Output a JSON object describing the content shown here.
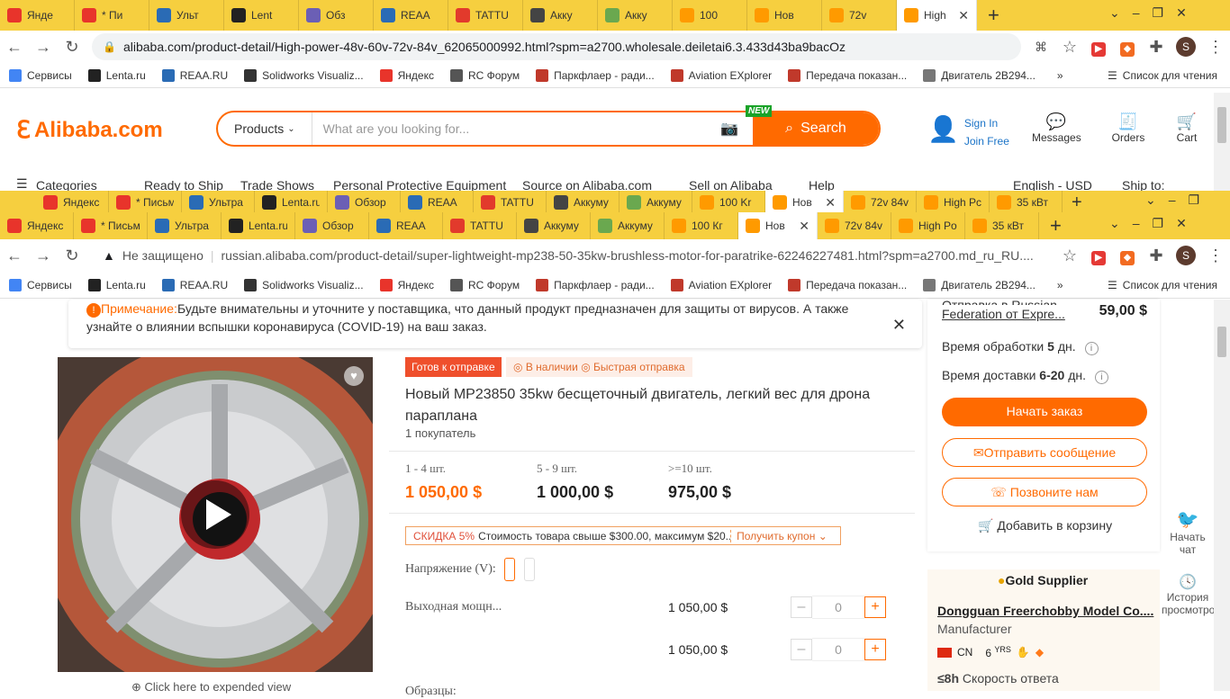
{
  "back_window": {
    "tabs": [
      {
        "label": "Янде",
        "icon": "yandex-icon",
        "color": "#e8342b"
      },
      {
        "label": "* Пи",
        "icon": "mail-icon",
        "color": "#e8342b"
      },
      {
        "label": "Ульт",
        "icon": "reaa-icon",
        "color": "#2a6bb5"
      },
      {
        "label": "Lent",
        "icon": "lenta-icon",
        "color": "#222222"
      },
      {
        "label": "Обз",
        "icon": "avatar-icon",
        "color": "#6b5fb5"
      },
      {
        "label": "REAA",
        "icon": "reaa-icon",
        "color": "#2a6bb5"
      },
      {
        "label": "TATTU",
        "icon": "tattu-icon",
        "color": "#e23a2c"
      },
      {
        "label": "Акку",
        "icon": "battery-icon",
        "color": "#444444"
      },
      {
        "label": "Акку",
        "icon": "dots-icon",
        "color": "#6aa84f"
      },
      {
        "label": "100",
        "icon": "alibaba-icon",
        "color": "#ff9a00"
      },
      {
        "label": "Нов",
        "icon": "alibaba-icon",
        "color": "#ff9a00"
      },
      {
        "label": "72v",
        "icon": "alibaba-icon",
        "color": "#ff9a00"
      },
      {
        "label": "High",
        "icon": "alibaba-icon",
        "color": "#ff9a00",
        "active": true
      }
    ],
    "url": "alibaba.com/product-detail/High-power-48v-60v-72v-84v_62065000992.html?spm=a2700.wholesale.deiletai6.3.433d43ba9bacOz",
    "profile_letter": "S"
  },
  "bookmarks": [
    {
      "label": "Сервисы",
      "icon": "apps-grid-icon",
      "color": "#4285f4"
    },
    {
      "label": "Lenta.ru",
      "icon": "lenta-icon",
      "color": "#222222"
    },
    {
      "label": "REAA.RU",
      "icon": "reaa-icon",
      "color": "#2a6bb5"
    },
    {
      "label": "Solidworks Visualiz...",
      "icon": "solidworks-icon",
      "color": "#333333"
    },
    {
      "label": "Яндекс",
      "icon": "yandex-icon",
      "color": "#e8342b"
    },
    {
      "label": "RC Форум",
      "icon": "rc-forum-icon",
      "color": "#555555"
    },
    {
      "label": "Паркфлаер - ради...",
      "icon": "parkflyer-icon",
      "color": "#c0392b"
    },
    {
      "label": "Aviation EXplorer",
      "icon": "aex-icon",
      "color": "#c0392b"
    },
    {
      "label": "Передача показан...",
      "icon": "document-icon",
      "color": "#c0392b"
    },
    {
      "label": "Двигатель 2В294...",
      "icon": "plane-icon",
      "color": "#777777"
    }
  ],
  "reading_list": "Список для чтения",
  "alibaba": {
    "logo": "Alibaba.com",
    "category": "Products",
    "search_placeholder": "What are you looking for...",
    "new_badge": "NEW",
    "search_button": "Search",
    "sign_in": "Sign In",
    "join_free": "Join Free",
    "messages": "Messages",
    "orders": "Orders",
    "cart": "Cart",
    "nav": [
      "Categories",
      "Ready to Ship",
      "Trade Shows",
      "Personal Protective Equipment",
      "Source on Alibaba.com",
      "Sell on Alibaba",
      "Help",
      "English - USD",
      "Ship to:"
    ]
  },
  "middle_window": {
    "tabs": [
      {
        "label": "Яндекс",
        "color": "#e8342b"
      },
      {
        "label": "* Письм",
        "color": "#e8342b"
      },
      {
        "label": "Ультра",
        "color": "#2a6bb5"
      },
      {
        "label": "Lenta.ru",
        "color": "#222222"
      },
      {
        "label": "Обзор",
        "color": "#6b5fb5"
      },
      {
        "label": "REAA",
        "color": "#2a6bb5"
      },
      {
        "label": "TATTU",
        "color": "#e23a2c"
      },
      {
        "label": "Аккуму",
        "color": "#444444"
      },
      {
        "label": "Аккуму",
        "color": "#6aa84f"
      },
      {
        "label": "100 Kr",
        "color": "#ff9a00"
      },
      {
        "label": "Нов",
        "color": "#ff9a00",
        "active": true
      },
      {
        "label": "72v 84v",
        "color": "#ff9a00"
      },
      {
        "label": "High Pc",
        "color": "#ff9a00"
      },
      {
        "label": "35 кВт",
        "color": "#ff9a00"
      }
    ]
  },
  "front_window": {
    "tabs": [
      {
        "label": "Яндекс",
        "color": "#e8342b"
      },
      {
        "label": "* Письм",
        "color": "#e8342b"
      },
      {
        "label": "Ультра",
        "color": "#2a6bb5"
      },
      {
        "label": "Lenta.ru",
        "color": "#222222"
      },
      {
        "label": "Обзор",
        "color": "#6b5fb5"
      },
      {
        "label": "REAA",
        "color": "#2a6bb5"
      },
      {
        "label": "TATTU",
        "color": "#e23a2c"
      },
      {
        "label": "Аккуму",
        "color": "#444444"
      },
      {
        "label": "Аккуму",
        "color": "#6aa84f"
      },
      {
        "label": "100 Кг",
        "color": "#ff9a00"
      },
      {
        "label": "Нов",
        "color": "#ff9a00",
        "active": true
      },
      {
        "label": "72v 84v",
        "color": "#ff9a00"
      },
      {
        "label": "High Po",
        "color": "#ff9a00"
      },
      {
        "label": "35 кВт",
        "color": "#ff9a00"
      }
    ],
    "insecure": "Не защищено",
    "url": "russian.alibaba.com/product-detail/super-lightweight-mp238-50-35kw-brushless-motor-for-paratrike-62246227481.html?spm=a2700.md_ru_RU....",
    "profile_letter": "S"
  },
  "product": {
    "notice_label": "Примечание:",
    "notice_text": "Будьте внимательны и уточните у поставщика, что данный продукт предназначен для защиты от вирусов. А также узнайте о влиянии вспышки коронавируса (COVID-19) на ваш заказ.",
    "ready_badge": "Готов к отправке",
    "in_stock": "В наличии",
    "fast_ship": "Быстрая отправка",
    "title": "Новый MP23850 35kw бесщеточный двигатель, легкий вес для дрона параплана",
    "buyers": "1 покупатель",
    "tiers": [
      {
        "qty": "1 - 4 шт.",
        "price": "1 050,00 $"
      },
      {
        "qty": "5 - 9 шт.",
        "price": "1 000,00 $"
      },
      {
        "qty": ">=10 шт.",
        "price": "975,00 $"
      }
    ],
    "coupon_tag": "СКИДКА 5%",
    "coupon_text": "Стоимость товара свыше $300.00, максимум $20...",
    "coupon_link": "Получить купон",
    "voltage_label": "Напряжение (V):",
    "power_label": "Выходная мощн...",
    "variants": [
      {
        "price": "1 050,00 $",
        "qty": "0"
      },
      {
        "price": "1 050,00 $",
        "qty": "0"
      }
    ],
    "samples_label": "Образцы:",
    "expand_view": "Click here to expended view"
  },
  "order_panel": {
    "shipping_line1": "Отправка в Russian",
    "shipping_line2": "Federation от Expre...",
    "shipping_price": "59,00 $",
    "processing_label": "Время обработки",
    "processing_value": "5",
    "processing_unit": "дн.",
    "delivery_label": "Время доставки",
    "delivery_value": "6-20",
    "delivery_unit": "дн.",
    "start_order": "Начать заказ",
    "send_message": "Отправить сообщение",
    "call_us": "Позвоните нам",
    "add_to_cart": "Добавить в корзину"
  },
  "supplier": {
    "badge": "Gold Supplier",
    "name": "Dongguan Freerchobby Model Co....",
    "type": "Manufacturer",
    "country": "CN",
    "years": "6",
    "years_unit": "YRS",
    "response_time": "≤8h",
    "response_label": "Скорость ответа"
  },
  "rail": {
    "chat": "Начать чат",
    "history": "История просмотро"
  },
  "colors": {
    "accent": "#ff6a00",
    "tab_bar": "#f6cf3f",
    "badge_red": "#ef4f2c"
  }
}
